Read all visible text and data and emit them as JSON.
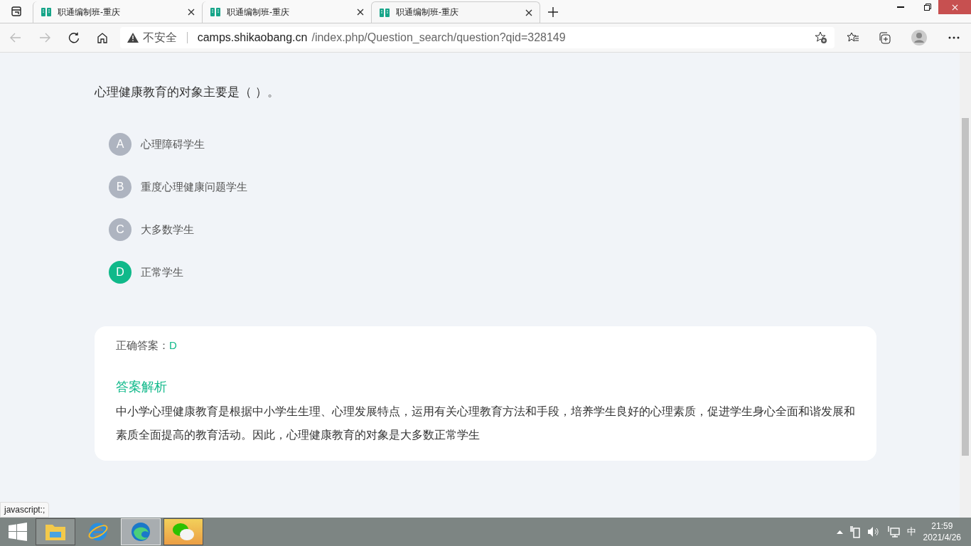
{
  "tabs": [
    {
      "title": "职通编制班-重庆",
      "selected": false
    },
    {
      "title": "职通编制班-重庆",
      "selected": false
    },
    {
      "title": "职通编制班-重庆",
      "selected": true
    }
  ],
  "address_bar": {
    "security": "不安全",
    "host": "camps.shikaobang.cn",
    "path": "/index.php/Question_search/question?qid=328149"
  },
  "question": {
    "text": "心理健康教育的对象主要是（   ）。",
    "options": [
      {
        "letter": "A",
        "text": "心理障碍学生",
        "selected": false
      },
      {
        "letter": "B",
        "text": "重度心理健康问题学生",
        "selected": false
      },
      {
        "letter": "C",
        "text": "大多数学生",
        "selected": false
      },
      {
        "letter": "D",
        "text": "正常学生",
        "selected": true
      }
    ]
  },
  "answer": {
    "label": "正确答案：",
    "value": "D",
    "analysis_title": "答案解析",
    "analysis": "中小学心理健康教育是根据中小学生生理、心理发展特点，运用有关心理教育方法和手段，培养学生良好的心理素质，促进学生身心全面和谐发展和素质全面提高的教育活动。因此，心理健康教育的对象是大多数正常学生"
  },
  "status_text": "javascript:;",
  "taskbar": {
    "apps": [
      {
        "kind": "explorer",
        "open": true,
        "active": false,
        "flashing": false
      },
      {
        "kind": "ie",
        "open": false,
        "active": false,
        "flashing": false
      },
      {
        "kind": "edge",
        "open": true,
        "active": true,
        "flashing": false
      },
      {
        "kind": "wechat",
        "open": true,
        "active": false,
        "flashing": true
      }
    ],
    "ime": "中",
    "time": "21:59",
    "date": "2021/4/26"
  }
}
